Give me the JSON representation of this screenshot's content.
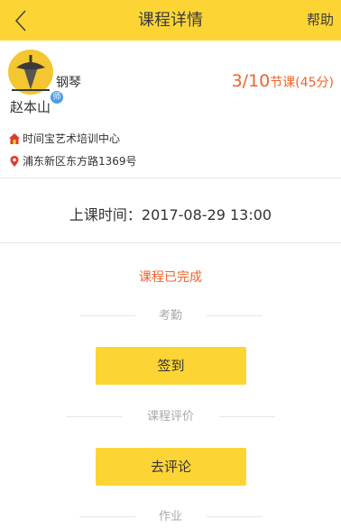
{
  "header": {
    "back_icon": "chevron-left-icon",
    "title": "课程详情",
    "help_label": "帮助"
  },
  "teacher": {
    "badge": "师",
    "subject": "钢琴",
    "name": "赵本山"
  },
  "lessons": {
    "progress": "3/10",
    "unit": "节课",
    "duration": "(45分)"
  },
  "school": {
    "icon": "home-icon",
    "name": "时间宝艺术培训中心"
  },
  "address": {
    "icon": "location-pin-icon",
    "text": "浦东新区东方路1369号"
  },
  "schedule": {
    "label": "上课时间：",
    "value": "2017-08-29 13:00"
  },
  "status": "课程已完成",
  "sections": {
    "attendance": {
      "title": "考勤",
      "button": "签到"
    },
    "evaluation": {
      "title": "课程评价",
      "button": "去评论"
    },
    "homework": {
      "title": "作业"
    }
  },
  "colors": {
    "brand_yellow": "#fcd535",
    "accent_orange": "#f0632a",
    "divider": "#e6e6e6",
    "muted_text": "#a9a9a9"
  }
}
